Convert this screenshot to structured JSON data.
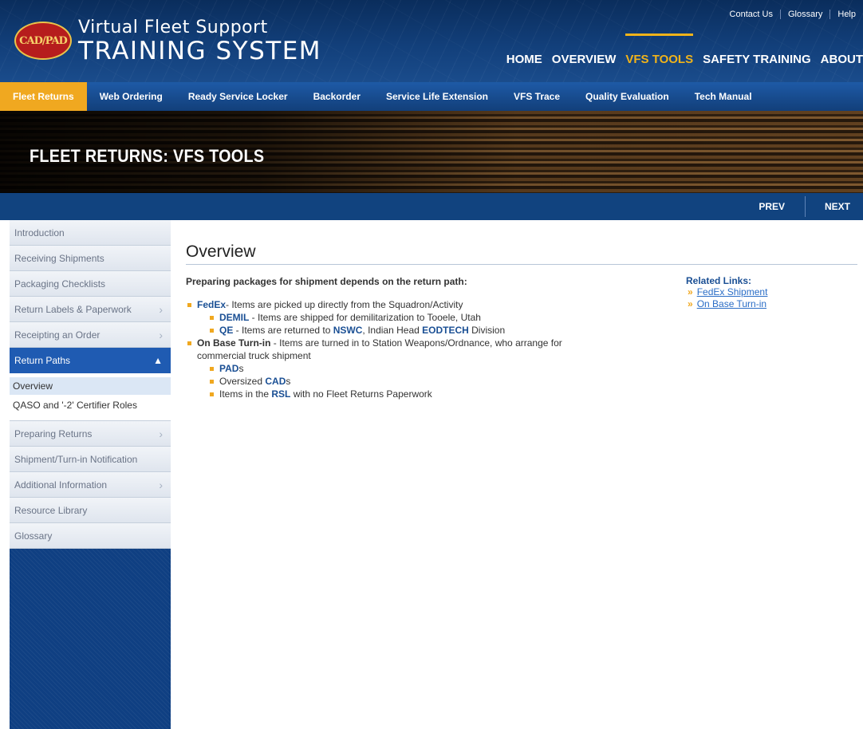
{
  "header": {
    "logo_text": "CAD/PAD",
    "title_line1": "Virtual Fleet Support",
    "title_line2": "TRAINING SYSTEM",
    "util_links": [
      "Contact Us",
      "Glossary",
      "Help"
    ],
    "main_nav": [
      {
        "label": "HOME",
        "active": false
      },
      {
        "label": "OVERVIEW",
        "active": false
      },
      {
        "label": "VFS TOOLS",
        "active": true
      },
      {
        "label": "SAFETY TRAINING",
        "active": false
      },
      {
        "label": "ABOUT",
        "active": false
      }
    ]
  },
  "sub_nav": [
    {
      "label": "Fleet Returns",
      "active": true
    },
    {
      "label": "Web Ordering"
    },
    {
      "label": "Ready Service Locker"
    },
    {
      "label": "Backorder"
    },
    {
      "label": "Service Life Extension"
    },
    {
      "label": "VFS Trace"
    },
    {
      "label": "Quality Evaluation"
    },
    {
      "label": "Tech Manual"
    }
  ],
  "banner": {
    "title": "FLEET RETURNS: VFS TOOLS"
  },
  "pager": {
    "prev": "PREV",
    "next": "NEXT"
  },
  "sidebar": {
    "items": [
      {
        "label": "Introduction"
      },
      {
        "label": "Receiving Shipments"
      },
      {
        "label": "Packaging Checklists"
      },
      {
        "label": "Return Labels & Paperwork"
      },
      {
        "label": "Receipting an Order"
      },
      {
        "label": "Return Paths"
      },
      {
        "label": "Preparing Returns"
      },
      {
        "label": "Shipment/Turn-in Notification"
      },
      {
        "label": "Additional Information"
      },
      {
        "label": "Resource Library"
      },
      {
        "label": "Glossary"
      }
    ],
    "sub_items": [
      {
        "label": "Overview"
      },
      {
        "label": "QASO and '-2' Certifier Roles"
      }
    ]
  },
  "content": {
    "title": "Overview",
    "intro": "Preparing packages for shipment depends on the return path:",
    "fedex": {
      "kw": "FedEx",
      "text": "- Items are picked up directly from the Squadron/Activity"
    },
    "demil": {
      "kw": "DEMIL",
      "text": " - Items are shipped for demilitarization to Tooele, Utah"
    },
    "qe": {
      "kw": "QE",
      "t1": " - Items are returned to ",
      "kw2": "NSWC",
      "t2": ", Indian Head ",
      "kw3": "EODTECH",
      "t3": " Division"
    },
    "onbase": {
      "kw": "On Base Turn-in",
      "text": " - Items are turned in to Station Weapons/Ordnance, who arrange for commercial truck shipment"
    },
    "pads": {
      "kw": "PAD",
      "text": "s"
    },
    "cads": {
      "pre": "Oversized ",
      "kw": "CAD",
      "text": "s"
    },
    "rsl": {
      "pre": "Items in the ",
      "kw": "RSL",
      "text": " with no Fleet Returns Paperwork"
    }
  },
  "related": {
    "title": "Related Links:",
    "links": [
      "FedEx Shipment",
      "On Base Turn-in"
    ]
  }
}
